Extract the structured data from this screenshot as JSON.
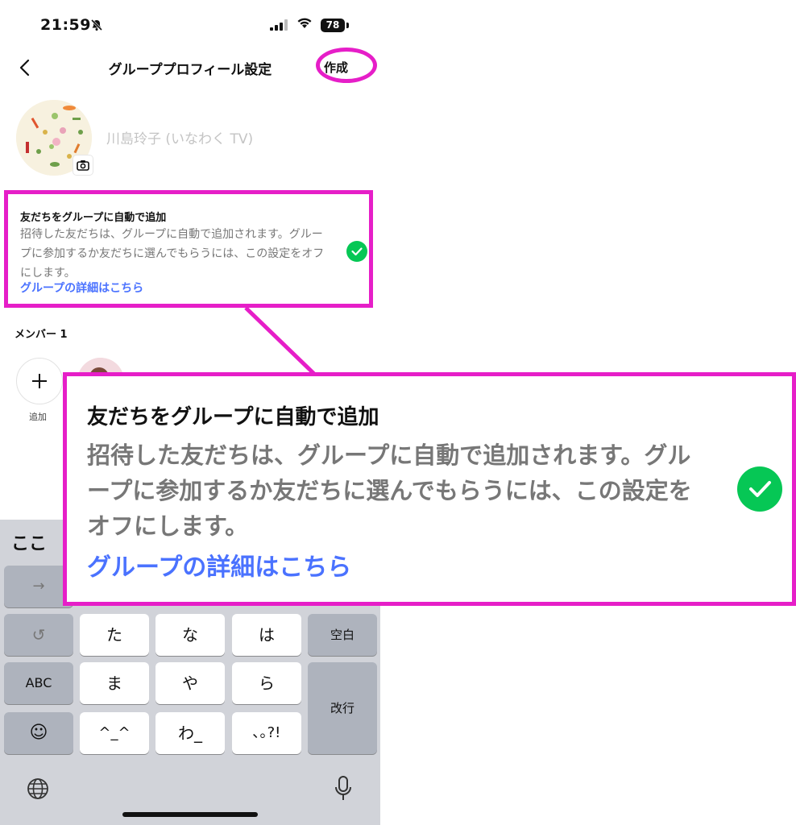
{
  "status_bar": {
    "time": "21:59",
    "battery": "78"
  },
  "nav": {
    "title": "グループプロフィール設定",
    "create_label": "作成"
  },
  "group": {
    "name_placeholder": "川島玲子 (いなわく TV)"
  },
  "auto_add": {
    "title": "友だちをグループに自動で追加",
    "description": "招待した友だちは、グループに自動で追加されます。グループに参加するか友だちに選んでもらうには、この設定をオフにします。",
    "link": "グループの詳細はこちら",
    "checked": true
  },
  "members": {
    "label": "メンバー 1",
    "add_label": "追加"
  },
  "keyboard": {
    "candidates": "ここ",
    "rows": [
      [
        "→"
      ],
      [
        "↺",
        "た",
        "な",
        "は",
        "空白"
      ],
      [
        "ABC",
        "ま",
        "や",
        "ら",
        "改行"
      ],
      [
        "☺",
        "^_^",
        "わ_",
        "､｡?!"
      ]
    ]
  },
  "icons": {
    "back": "chevron-left-icon",
    "camera": "camera-icon",
    "check": "check-icon",
    "plus": "plus-icon",
    "globe": "globe-icon",
    "mic": "microphone-icon"
  },
  "colors": {
    "highlight": "#e61ec8",
    "accent_green": "#06c755",
    "link_blue": "#4a72ff"
  }
}
